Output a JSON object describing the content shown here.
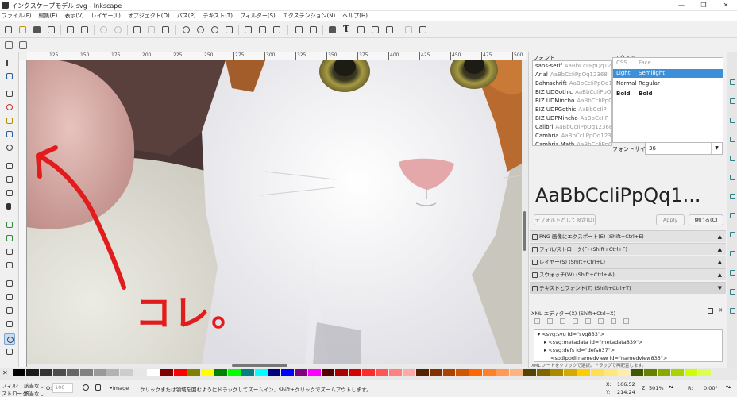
{
  "window": {
    "title": "インクスケープモデル.svg - Inkscape",
    "buttons": [
      "—",
      "❐",
      "✕"
    ]
  },
  "menu": [
    "ファイル(F)",
    "編集(E)",
    "表示(V)",
    "レイヤー(L)",
    "オブジェクト(O)",
    "パス(P)",
    "テキスト(T)",
    "フィルター(S)",
    "エクステンション(N)",
    "ヘルプ(H)"
  ],
  "ruler": {
    "labels": [
      "125",
      "150",
      "175",
      "200",
      "225",
      "250",
      "275",
      "300",
      "325",
      "350",
      "375",
      "400",
      "425",
      "450",
      "475",
      "500"
    ]
  },
  "canvas": {
    "annotation": "コレ。"
  },
  "text_font_panel": {
    "font_label": "フォント",
    "style_label": "スタイル",
    "fonts": [
      {
        "name": "sans-serif",
        "preview": "AaBbCcIiPpQq12368"
      },
      {
        "name": "Arial",
        "preview": "AaBbCcIiPpQq12368"
      },
      {
        "name": "Bahnschrift",
        "preview": "AaBbCcIiPpQq1236"
      },
      {
        "name": "BIZ UDGothic",
        "preview": "AaBbCcIiPpQ"
      },
      {
        "name": "BIZ UDMincho",
        "preview": "AaBbCcIiPpQ"
      },
      {
        "name": "BIZ UDPGothic",
        "preview": "AaBbCcIiP"
      },
      {
        "name": "BIZ UDPMincho",
        "preview": "AaBbCcIiP"
      },
      {
        "name": "Calibri",
        "preview": "AaBbCcIiPpQq12368"
      },
      {
        "name": "Cambria",
        "preview": "AaBbCcIiPpQq1236"
      },
      {
        "name": "Cambria Math",
        "preview": "AaBbCcIiPpQq12"
      }
    ],
    "styles": [
      {
        "css": "CSS",
        "face": "Face",
        "header": true
      },
      {
        "css": "Light",
        "face": "Semilight",
        "selected": true
      },
      {
        "css": "Normal",
        "face": "Regular"
      },
      {
        "css": "Bold",
        "face": "Bold",
        "bold": true
      }
    ],
    "size_label": "フォントサイズ",
    "size_value": "36",
    "preview_text": "AaBbCcIiPpQq1...",
    "default_button": "デフォルトとして設定(D)",
    "apply_button": "Apply",
    "close_button": "閉じる(C)"
  },
  "panels": [
    {
      "label": "PNG 画像にエクスポート(E) (Shift+Ctrl+E)",
      "icon": "export-icon"
    },
    {
      "label": "フィル/ストローク(F) (Shift+Ctrl+F)",
      "icon": "fill-stroke-icon"
    },
    {
      "label": "レイヤー(S) (Shift+Ctrl+L)",
      "icon": "layers-icon"
    },
    {
      "label": "スウォッチ(W) (Shift+Ctrl+W)",
      "icon": "swatches-icon"
    },
    {
      "label": "テキストとフォント(T) (Shift+Ctrl+T)",
      "icon": "text-icon",
      "open": true
    }
  ],
  "xml_editor": {
    "title": "XML エディター(X) (Shift+Ctrl+X)",
    "nodes": [
      "<svg:svg id=\"svg833\">",
      "<svg:metadata id=\"metadata839\">",
      "<svg:defs id=\"defs837\">",
      "<sodipodi:namedview id=\"namedview835\">"
    ],
    "footer": "XML ノードをクリックで選択。ドラッグで再配置します。"
  },
  "palette": {
    "colors": [
      "#000000",
      "#1a1a1a",
      "#333333",
      "#4d4d4d",
      "#666666",
      "#808080",
      "#999999",
      "#b3b3b3",
      "#cccccc",
      "#e6e6e6",
      "#ffffff",
      "#800000",
      "#ff0000",
      "#808000",
      "#ffff00",
      "#008000",
      "#00ff00",
      "#008080",
      "#00ffff",
      "#000080",
      "#0000ff",
      "#800080",
      "#ff00ff",
      "#550000",
      "#aa0000",
      "#d40000",
      "#ff2a2a",
      "#ff5555",
      "#ff8080",
      "#ffaaaa",
      "#552200",
      "#803300",
      "#aa4400",
      "#d45500",
      "#ff6600",
      "#ff7f2a",
      "#ff9955",
      "#ffb380",
      "#554400",
      "#806600",
      "#aa8800",
      "#d4aa00",
      "#ffcc00",
      "#ffdd55",
      "#ffe680",
      "#ffeeaa",
      "#445500",
      "#668000",
      "#88aa00",
      "#aad400",
      "#ccff00",
      "#ddff55"
    ]
  },
  "status": {
    "fill_label": "フィル:",
    "fill_value": "該当なし",
    "stroke_label": "ストローク:",
    "stroke_value": "該当なし",
    "opacity_label": "O:",
    "opacity_value": "100",
    "layer": "•Image",
    "message": "クリックまたは領域を囲むようにドラッグしてズームイン、Shift+クリックでズームアウトします。",
    "x_label": "X:",
    "x_value": "166.52",
    "y_label": "Y:",
    "y_value": "214.24",
    "zoom_label": "Z:",
    "zoom_value": "501%",
    "rotation_label": "R:",
    "rotation_value": "0.00°"
  }
}
